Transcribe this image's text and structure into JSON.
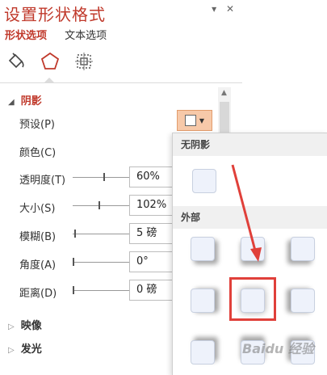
{
  "pane": {
    "title": "设置形状格式",
    "controls": {
      "dropdown": "▾",
      "close": "✕"
    }
  },
  "tabs": [
    {
      "label": "形状选项",
      "active": true
    },
    {
      "label": "文本选项",
      "active": false
    }
  ],
  "icons": [
    "paint-bucket-icon",
    "pentagon-icon",
    "size-properties-icon"
  ],
  "shadow_section": {
    "title": "阴影",
    "rows": {
      "preset": "预设(P)",
      "color": "颜色(C)",
      "transparency": {
        "label": "透明度(T)",
        "value": "60%",
        "level": 0.6
      },
      "size": {
        "label": "大小(S)",
        "value": "102%",
        "level": 0.51
      },
      "blur": {
        "label": "模糊(B)",
        "value": "5 磅",
        "level": 0.05
      },
      "angle": {
        "label": "角度(A)",
        "value": "0°",
        "level": 0.0
      },
      "distance": {
        "label": "距离(D)",
        "value": "0 磅",
        "level": 0.0
      }
    }
  },
  "collapsed_sections": [
    {
      "title": "映像"
    },
    {
      "title": "发光"
    }
  ],
  "dropdown": {
    "no_shadow_label": "无阴影",
    "outer_label": "外部"
  },
  "watermark": "Baidu 经验",
  "colors": {
    "accent": "#c0392b",
    "preset_button_bg": "#f7c9a9",
    "highlight": "#e0403a",
    "arrow": "#e0403a"
  }
}
